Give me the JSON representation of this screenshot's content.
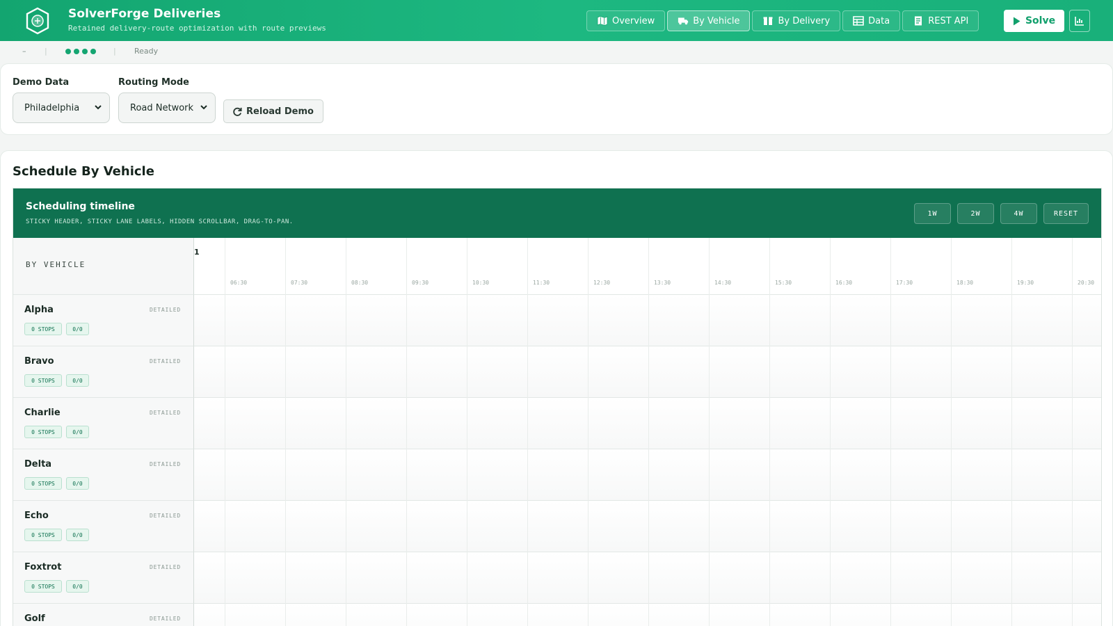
{
  "app": {
    "title": "SolverForge Deliveries",
    "subtitle": "Retained delivery-route optimization with route previews"
  },
  "nav": {
    "tabs": [
      {
        "label": "Overview",
        "icon": "map-icon",
        "active": false
      },
      {
        "label": "By Vehicle",
        "icon": "truck-icon",
        "active": true
      },
      {
        "label": "By Delivery",
        "icon": "package-icon",
        "active": false
      },
      {
        "label": "Data",
        "icon": "table-icon",
        "active": false
      },
      {
        "label": "REST API",
        "icon": "document-icon",
        "active": false
      }
    ],
    "solve_label": "Solve",
    "chart_icon": "chart-icon"
  },
  "status": {
    "dash": "–",
    "sep": "|",
    "text": "Ready"
  },
  "controls": {
    "demo_data_label": "Demo Data",
    "demo_data_value": "Philadelphia",
    "routing_mode_label": "Routing Mode",
    "routing_mode_value": "Road Network",
    "reload_label": "Reload Demo"
  },
  "schedule": {
    "title": "Schedule By Vehicle",
    "timeline_title": "Scheduling timeline",
    "timeline_subtitle": "STICKY HEADER, STICKY LANE LABELS, HIDDEN SCROLLBAR, DRAG-TO-PAN.",
    "zoom_buttons": [
      "1W",
      "2W",
      "4W",
      "RESET"
    ],
    "lane_header": "BY VEHICLE",
    "date_marker": "1",
    "time_ticks": [
      "06:30",
      "07:30",
      "08:30",
      "09:30",
      "10:30",
      "11:30",
      "12:30",
      "13:30",
      "14:30",
      "15:30",
      "16:30",
      "17:30",
      "18:30",
      "19:30",
      "20:30"
    ],
    "vehicles": [
      {
        "name": "Alpha",
        "mode": "DETAILED",
        "stops": "0 STOPS",
        "load": "0/0"
      },
      {
        "name": "Bravo",
        "mode": "DETAILED",
        "stops": "0 STOPS",
        "load": "0/0"
      },
      {
        "name": "Charlie",
        "mode": "DETAILED",
        "stops": "0 STOPS",
        "load": "0/0"
      },
      {
        "name": "Delta",
        "mode": "DETAILED",
        "stops": "0 STOPS",
        "load": "0/0"
      },
      {
        "name": "Echo",
        "mode": "DETAILED",
        "stops": "0 STOPS",
        "load": "0/0"
      },
      {
        "name": "Foxtrot",
        "mode": "DETAILED",
        "stops": "0 STOPS",
        "load": "0/0"
      },
      {
        "name": "Golf",
        "mode": "DETAILED",
        "stops": "0 STOPS",
        "load": "0/0"
      }
    ]
  }
}
